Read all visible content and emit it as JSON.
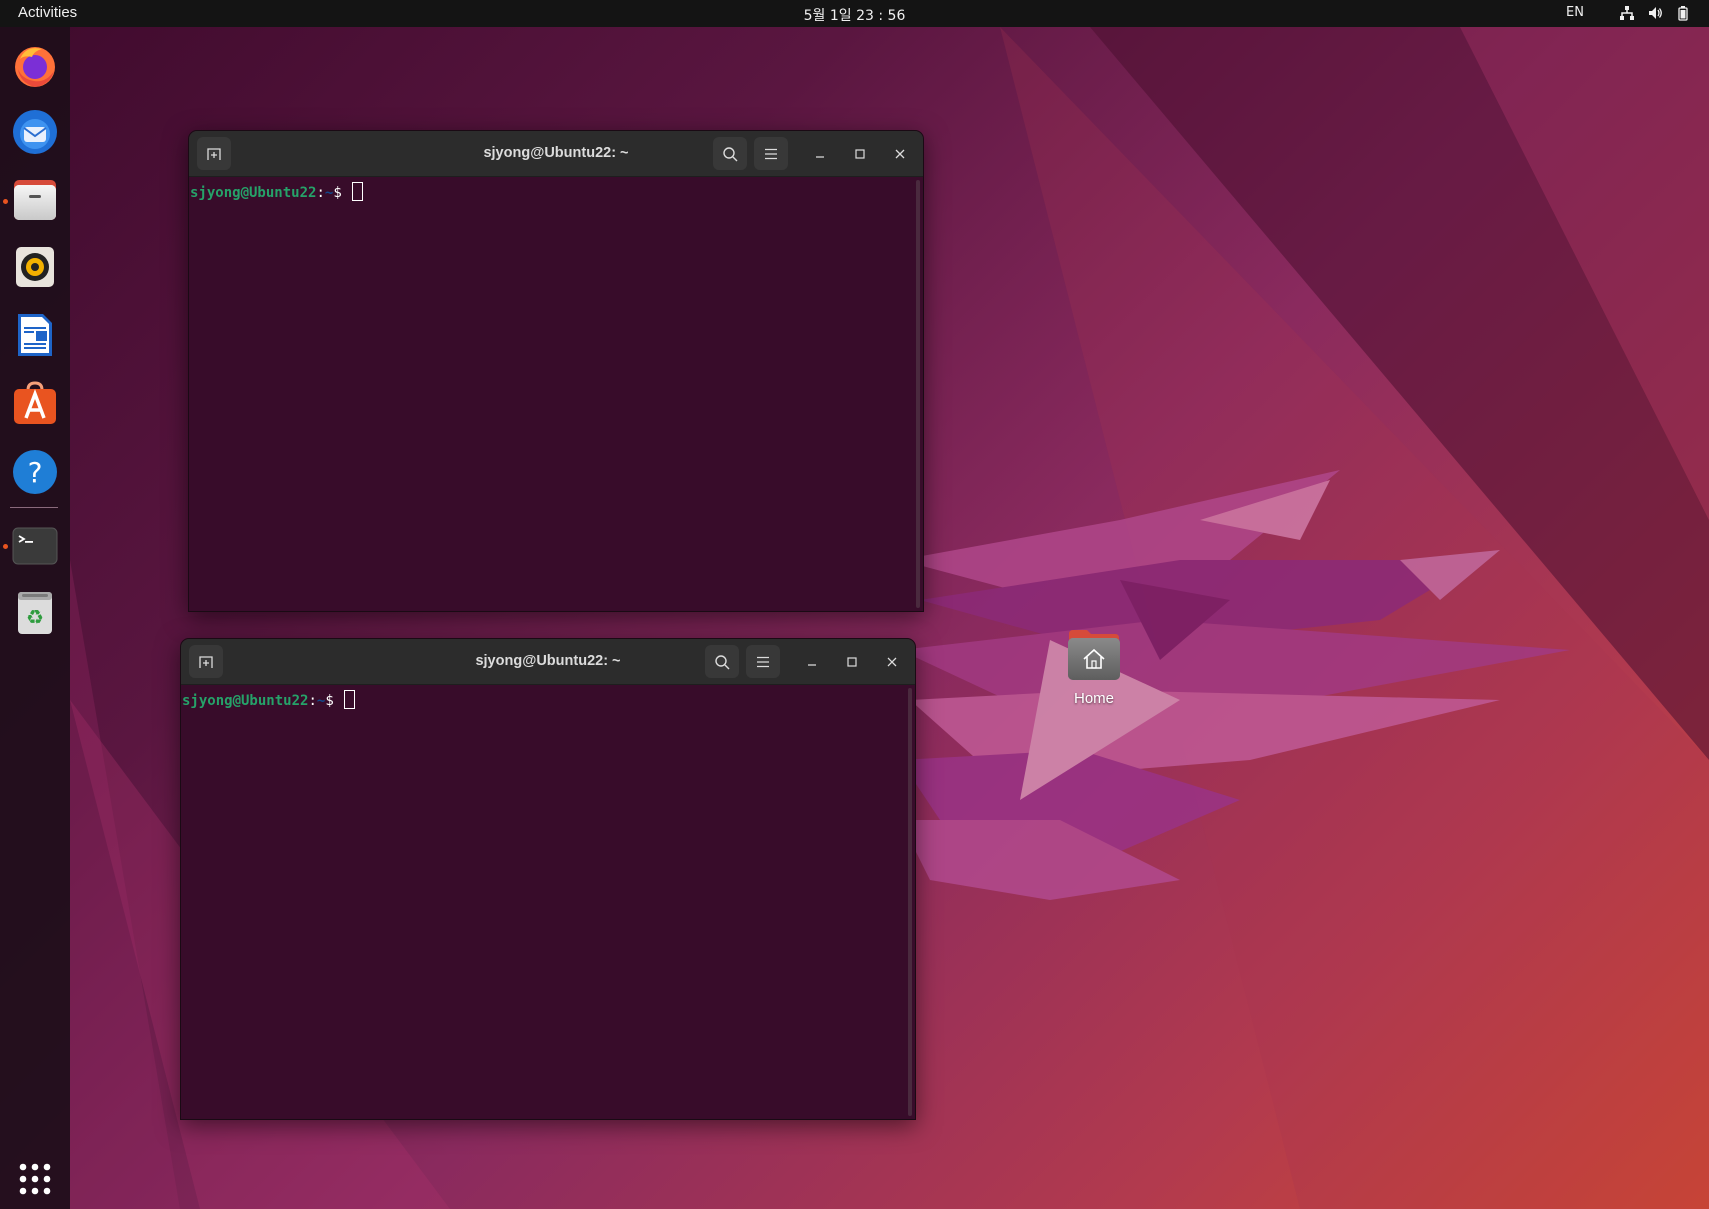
{
  "topbar": {
    "activities_label": "Activities",
    "clock": "5월 1일  23 : 56",
    "language": "EN",
    "tray_icons": [
      "network-icon",
      "volume-icon",
      "battery-icon"
    ]
  },
  "dock": {
    "items": [
      {
        "name": "firefox",
        "running": false
      },
      {
        "name": "thunderbird",
        "running": false
      },
      {
        "name": "files",
        "running": true
      },
      {
        "name": "rhythmbox",
        "running": false
      },
      {
        "name": "libreoffice-writer",
        "running": false
      },
      {
        "name": "ubuntu-software",
        "running": false
      },
      {
        "name": "help",
        "running": false
      },
      {
        "name": "terminal",
        "running": true
      },
      {
        "name": "trash",
        "running": false
      }
    ],
    "show_apps": "show-applications-icon"
  },
  "terminals": [
    {
      "title": "sjyong@Ubuntu22: ~",
      "prompt_user": "sjyong@Ubuntu22",
      "prompt_sep": ":",
      "prompt_path": "~",
      "prompt_symbol": "$ "
    },
    {
      "title": "sjyong@Ubuntu22: ~",
      "prompt_user": "sjyong@Ubuntu22",
      "prompt_sep": ":",
      "prompt_path": "~",
      "prompt_symbol": "$ "
    }
  ],
  "desktop": {
    "home_label": "Home"
  },
  "colors": {
    "accent": "#e95420",
    "terminal_bg": "#380c2a",
    "prompt_user": "#26a269",
    "prompt_path": "#12488b"
  }
}
